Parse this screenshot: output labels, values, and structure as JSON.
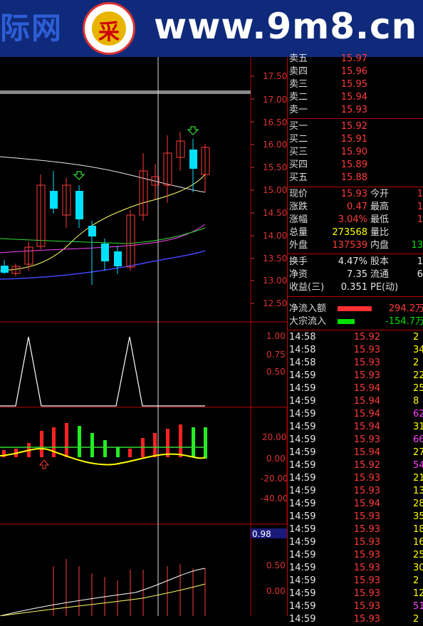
{
  "banner": {
    "brand": "际网",
    "logo_glyph": "采",
    "url": "www.9m8.cn"
  },
  "price_axis": [
    "17.50",
    "17.00",
    "16.50",
    "16.00",
    "15.50",
    "15.00",
    "14.50",
    "14.00",
    "13.50",
    "13.00",
    "12.50"
  ],
  "osc_axis": [
    "1.00",
    "0.75",
    "0.50"
  ],
  "macd_axis": [
    "20.00",
    "0.00",
    "-20.00",
    "-40.00"
  ],
  "vol_axis": [
    "0.98",
    "0.50",
    "0.00"
  ],
  "orderbook": {
    "sell": [
      {
        "label": "卖五",
        "price": "15.97"
      },
      {
        "label": "卖四",
        "price": "15.96"
      },
      {
        "label": "卖三",
        "price": "15.95"
      },
      {
        "label": "卖二",
        "price": "15.94"
      },
      {
        "label": "卖一",
        "price": "15.93"
      }
    ],
    "buy": [
      {
        "label": "买一",
        "price": "15.92"
      },
      {
        "label": "买二",
        "price": "15.91"
      },
      {
        "label": "买三",
        "price": "15.90"
      },
      {
        "label": "买四",
        "price": "15.89"
      },
      {
        "label": "买五",
        "price": "15.88"
      }
    ]
  },
  "quote": {
    "xianjia_label": "现价",
    "xianjia": "15.93",
    "jinkai_label": "今开",
    "jinkai": "1",
    "zhangdie_label": "涨跌",
    "zhangdie": "0.47",
    "zuigao_label": "最高",
    "zuigao": "1",
    "zhangfu_label": "涨幅",
    "zhangfu": "3.04%",
    "zuidi_label": "最低",
    "zuidi": "1",
    "zongliang_label": "总量",
    "zongliang": "273568",
    "liangbi_label": "量比",
    "liangbi": "",
    "waipan_label": "外盘",
    "waipan": "137539",
    "neipan_label": "内盘",
    "neipan": "13",
    "huanshou_label": "换手",
    "huanshou": "4.47%",
    "guben_label": "股本",
    "guben": "1",
    "jingzi_label": "净资",
    "jingzi": "7.35",
    "liutong_label": "流通",
    "liutong": "6",
    "shouyi_label": "收益(三)",
    "shouyi": "0.351",
    "pe_label": "PE(动)",
    "pe": ""
  },
  "flow": {
    "net_label": "净流入额",
    "net": "294.2万",
    "block_label": "大宗流入",
    "block": "-154.7万"
  },
  "ticks": [
    {
      "t": "14:58",
      "p": "15.92",
      "pc": "red",
      "v": "2",
      "vc": "yellow"
    },
    {
      "t": "14:58",
      "p": "15.93",
      "pc": "red",
      "v": "34",
      "vc": "yellow"
    },
    {
      "t": "14:58",
      "p": "15.93",
      "pc": "red",
      "v": "2",
      "vc": "yellow"
    },
    {
      "t": "14:59",
      "p": "15.93",
      "pc": "red",
      "v": "22",
      "vc": "yellow"
    },
    {
      "t": "14:59",
      "p": "15.94",
      "pc": "red",
      "v": "25",
      "vc": "yellow"
    },
    {
      "t": "14:59",
      "p": "15.94",
      "pc": "red",
      "v": "8",
      "vc": "yellow"
    },
    {
      "t": "14:59",
      "p": "15.94",
      "pc": "red",
      "v": "62",
      "vc": "magenta"
    },
    {
      "t": "14:59",
      "p": "15.94",
      "pc": "red",
      "v": "31",
      "vc": "yellow"
    },
    {
      "t": "14:59",
      "p": "15.93",
      "pc": "red",
      "v": "66",
      "vc": "magenta"
    },
    {
      "t": "14:59",
      "p": "15.94",
      "pc": "red",
      "v": "27",
      "vc": "yellow"
    },
    {
      "t": "14:59",
      "p": "15.92",
      "pc": "red",
      "v": "54",
      "vc": "magenta"
    },
    {
      "t": "14:59",
      "p": "15.93",
      "pc": "red",
      "v": "21",
      "vc": "yellow"
    },
    {
      "t": "14:59",
      "p": "15.93",
      "pc": "red",
      "v": "13",
      "vc": "yellow"
    },
    {
      "t": "14:59",
      "p": "15.94",
      "pc": "red",
      "v": "28",
      "vc": "yellow"
    },
    {
      "t": "14:59",
      "p": "15.93",
      "pc": "red",
      "v": "35",
      "vc": "yellow"
    },
    {
      "t": "14:59",
      "p": "15.93",
      "pc": "red",
      "v": "18",
      "vc": "yellow"
    },
    {
      "t": "14:59",
      "p": "15.93",
      "pc": "red",
      "v": "16",
      "vc": "yellow"
    },
    {
      "t": "14:59",
      "p": "15.93",
      "pc": "red",
      "v": "25",
      "vc": "yellow"
    },
    {
      "t": "14:59",
      "p": "15.93",
      "pc": "red",
      "v": "30",
      "vc": "yellow"
    },
    {
      "t": "14:59",
      "p": "15.93",
      "pc": "red",
      "v": "2",
      "vc": "yellow"
    },
    {
      "t": "14:59",
      "p": "15.93",
      "pc": "red",
      "v": "12",
      "vc": "yellow"
    },
    {
      "t": "14:59",
      "p": "15.93",
      "pc": "red",
      "v": "51",
      "vc": "magenta"
    },
    {
      "t": "14:59",
      "p": "15.93",
      "pc": "red",
      "v": "2",
      "vc": "yellow"
    }
  ]
}
